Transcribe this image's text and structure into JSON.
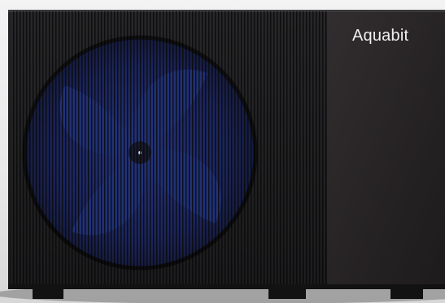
{
  "product": {
    "brand_logo_text": "Aquabit"
  },
  "colors": {
    "cabinet": "#1b1b1d",
    "panel": "#2a2728",
    "fan_blade": "#1b2c73",
    "grille": "#111112",
    "floor": "#d8d8d8"
  }
}
